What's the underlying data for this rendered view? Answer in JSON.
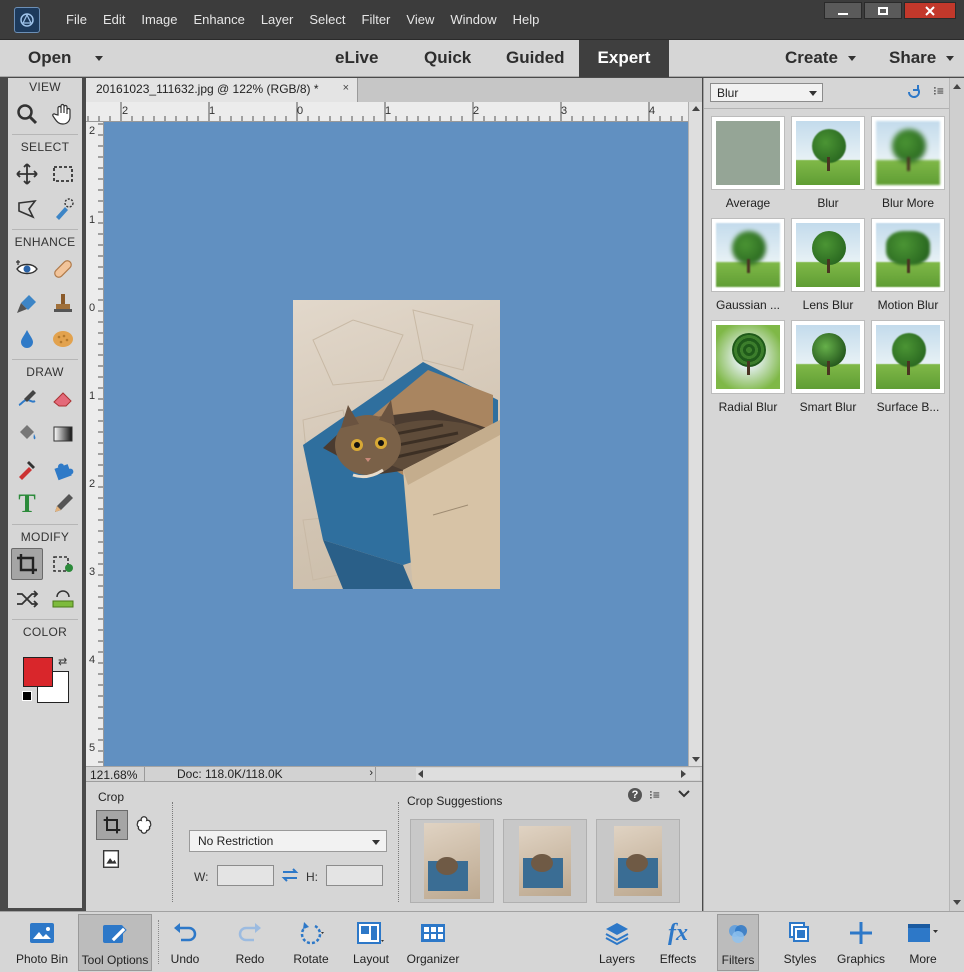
{
  "menu": [
    "File",
    "Edit",
    "Image",
    "Enhance",
    "Layer",
    "Select",
    "Filter",
    "View",
    "Window",
    "Help"
  ],
  "window_controls": {
    "minimize": "▁",
    "maximize": "□",
    "close": "✕"
  },
  "modebar": {
    "open_label": "Open",
    "modes": [
      "eLive",
      "Quick",
      "Guided",
      "Expert"
    ],
    "active_mode": "Expert",
    "create_label": "Create",
    "share_label": "Share"
  },
  "toolbox": {
    "sections": [
      "VIEW",
      "SELECT",
      "ENHANCE",
      "DRAW",
      "MODIFY",
      "COLOR"
    ],
    "foreground_color": "#d9262b",
    "background_color": "#ffffff"
  },
  "document": {
    "tab_title": "20161023_111632.jpg @ 122% (RGB/8) *",
    "tab_close": "×",
    "canvas_color": "#6190c1",
    "zoom": "121.68%",
    "doc_size": "Doc: 118.0K/118.0K"
  },
  "rulers": {
    "top": [
      "2",
      "1",
      "0",
      "1",
      "2",
      "3",
      "4"
    ],
    "left": [
      "2",
      "1",
      "0",
      "1",
      "2",
      "3",
      "4",
      "5"
    ]
  },
  "tool_options": {
    "title": "Crop",
    "restriction": "No Restriction",
    "w_label": "W:",
    "h_label": "H:",
    "crop_suggestions_title": "Crop Suggestions"
  },
  "filters_panel": {
    "category": "Blur",
    "items": [
      {
        "label": "Average",
        "icon": "average-swatch"
      },
      {
        "label": "Blur",
        "icon": "tree-blur"
      },
      {
        "label": "Blur More",
        "icon": "tree-blur-more"
      },
      {
        "label": "Gaussian ...",
        "icon": "tree-gaussian"
      },
      {
        "label": "Lens Blur",
        "icon": "tree-lens"
      },
      {
        "label": "Motion Blur",
        "icon": "tree-motion"
      },
      {
        "label": "Radial Blur",
        "icon": "tree-radial"
      },
      {
        "label": "Smart Blur",
        "icon": "tree-smart"
      },
      {
        "label": "Surface B...",
        "icon": "tree-surface"
      }
    ]
  },
  "taskbar": {
    "left": [
      "Photo Bin",
      "Tool Options",
      "Undo",
      "Redo",
      "Rotate",
      "Layout",
      "Organizer"
    ],
    "right": [
      "Layers",
      "Effects",
      "Filters",
      "Styles",
      "Graphics",
      "More"
    ],
    "active": "Filters",
    "accent": "#2d78c8"
  }
}
